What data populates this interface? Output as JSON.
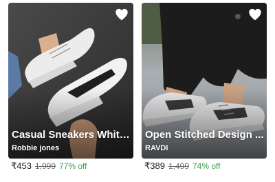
{
  "products": [
    {
      "title": "Casual Sneakers White...",
      "brand": "Robbie jones",
      "price": "₹453",
      "mrp": "1,999",
      "discount": "77% off",
      "favorite_icon": "heart-icon"
    },
    {
      "title": "Open Stitched Design ...",
      "brand": "RAVDI",
      "price": "₹389",
      "mrp": "1,499",
      "discount": "74% off",
      "favorite_icon": "heart-icon"
    }
  ],
  "colors": {
    "discount": "#35a04a",
    "price": "#212121",
    "mrp": "#6b6b6b",
    "overlay_text": "#ffffff"
  }
}
